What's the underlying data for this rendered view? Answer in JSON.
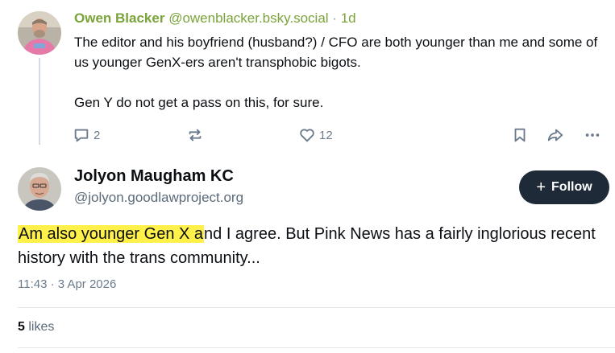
{
  "parent_post": {
    "author_name": "Owen Blacker",
    "author_handle": "@owenblacker.bsky.social",
    "separator": "·",
    "time": "1d",
    "text_paragraph_1": "The editor and his boyfriend (husband?) / CFO are both younger than me and some of us younger GenX-ers aren't transphobic bigots.",
    "text_paragraph_2": "Gen Y do not get a pass on this, for sure.",
    "actions": {
      "reply_count": "2",
      "repost_count": "",
      "like_count": "12"
    }
  },
  "main_post": {
    "author_name": "Jolyon Maugham KC",
    "author_handle": "@jolyon.goodlawproject.org",
    "follow_button": {
      "icon": "+",
      "label": "Follow"
    },
    "text_highlighted": "Am also younger Gen X a",
    "text_rest": "nd I agree. But Pink News has a fairly inglorious recent history with the trans community...",
    "timestamp": "11:43 · 3 Apr 2026",
    "likes_count": "5",
    "likes_label": "likes"
  },
  "colors": {
    "accent_green": "#7aa33a",
    "highlight": "#fff04a",
    "follow_bg": "#1e2a38",
    "muted": "#6b7b8c"
  },
  "icons": [
    "reply-icon",
    "repost-icon",
    "heart-icon",
    "bookmark-icon",
    "share-icon",
    "more-icon"
  ]
}
